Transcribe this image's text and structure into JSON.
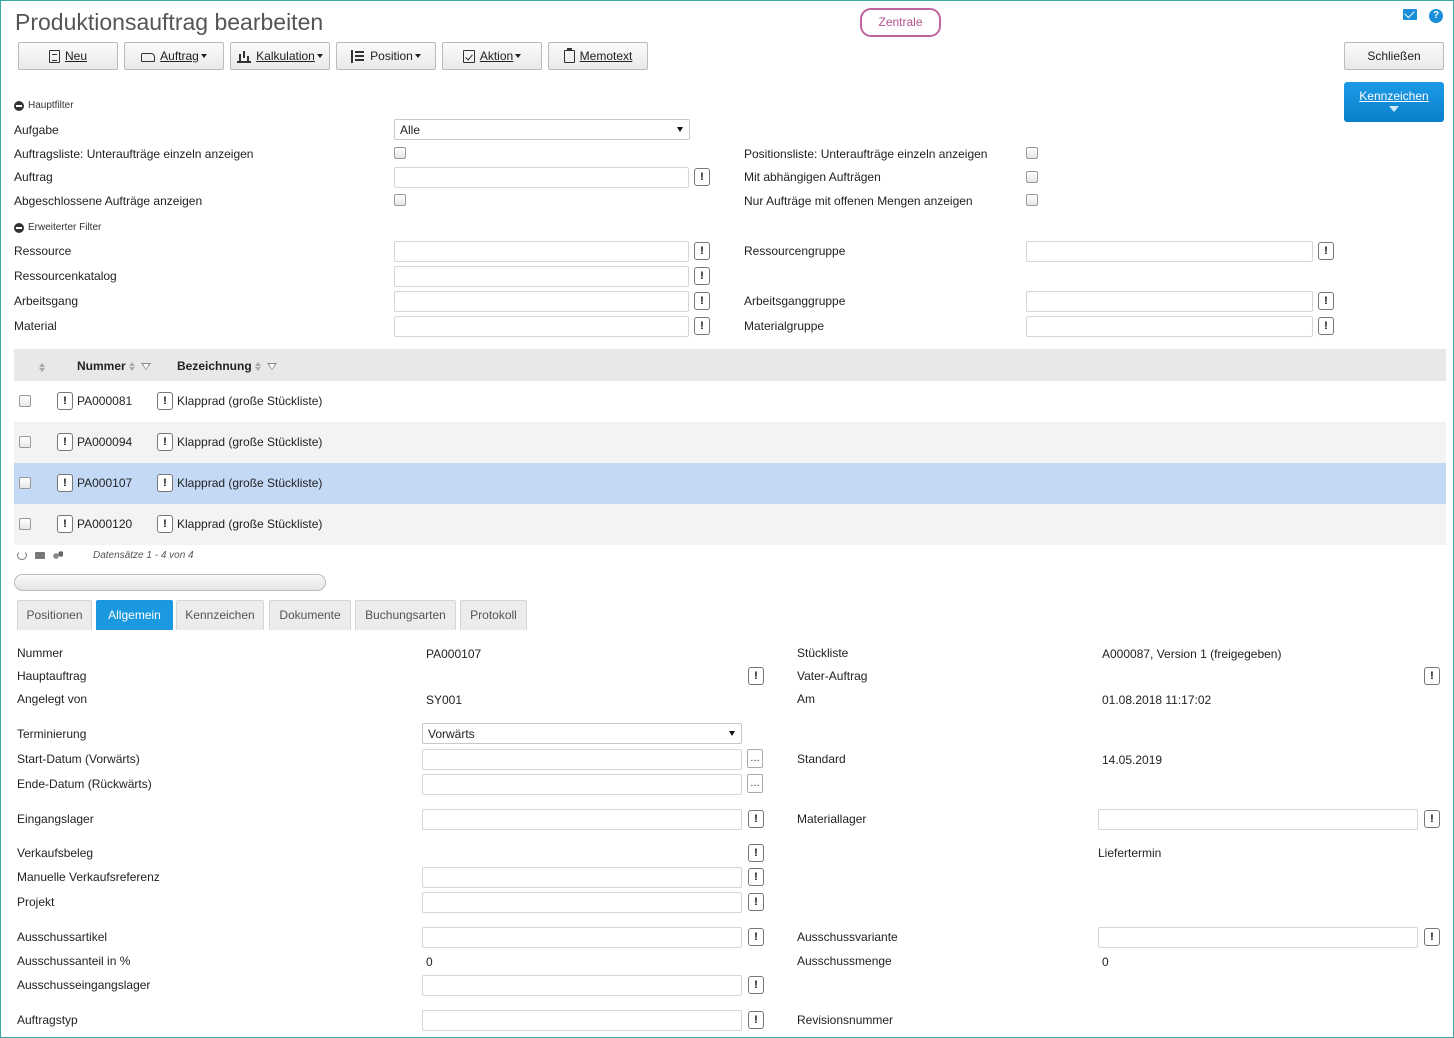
{
  "header": {
    "title": "Produktionsauftrag bearbeiten",
    "zentrale": "Zentrale"
  },
  "toolbar": {
    "neu": "Neu",
    "auftrag": "Auftrag",
    "kalkulation": "Kalkulation",
    "position": "Position",
    "aktion": "Aktion",
    "memotext": "Memotext",
    "schliessen": "Schließen",
    "kennzeichen": "Kennzeichen"
  },
  "hauptfilter": {
    "title": "Hauptfilter",
    "aufgabe_label": "Aufgabe",
    "aufgabe_value": "Alle",
    "unterauftraege_label": "Auftragsliste: Unteraufträge einzeln anzeigen",
    "auftrag_label": "Auftrag",
    "abgeschlossen_label": "Abgeschlossene Aufträge anzeigen",
    "pos_unterauftraege_label": "Positionsliste: Unteraufträge einzeln anzeigen",
    "abhaengig_label": "Mit abhängigen Aufträgen",
    "offene_mengen_label": "Nur Aufträge mit offenen Mengen anzeigen"
  },
  "erweiterter_filter": {
    "title": "Erweiterter Filter",
    "ressource": "Ressource",
    "ressourcenkatalog": "Ressourcenkatalog",
    "arbeitsgang": "Arbeitsgang",
    "material": "Material",
    "ressourcengruppe": "Ressourcengruppe",
    "arbeitsganggruppe": "Arbeitsganggruppe",
    "materialgruppe": "Materialgruppe"
  },
  "grid": {
    "col_nummer": "Nummer",
    "col_bezeichnung": "Bezeichnung",
    "rows": [
      {
        "nummer": "PA000081",
        "bezeichnung": "Klapprad (große Stückliste)"
      },
      {
        "nummer": "PA000094",
        "bezeichnung": "Klapprad (große Stückliste)"
      },
      {
        "nummer": "PA000107",
        "bezeichnung": "Klapprad (große Stückliste)"
      },
      {
        "nummer": "PA000120",
        "bezeichnung": "Klapprad (große Stückliste)"
      }
    ],
    "records": "Datensätze 1 - 4 von 4"
  },
  "tabs": [
    "Positionen",
    "Allgemein",
    "Kennzeichen",
    "Dokumente",
    "Buchungsarten",
    "Protokoll"
  ],
  "detail": {
    "nummer_label": "Nummer",
    "nummer_value": "PA000107",
    "hauptauftrag_label": "Hauptauftrag",
    "angelegt_label": "Angelegt von",
    "angelegt_value": "SY001",
    "terminierung_label": "Terminierung",
    "terminierung_value": "Vorwärts",
    "start_label": "Start-Datum (Vorwärts)",
    "ende_label": "Ende-Datum (Rückwärts)",
    "eingangslager_label": "Eingangslager",
    "verkaufsbeleg_label": "Verkaufsbeleg",
    "manuelle_label": "Manuelle Verkaufsreferenz",
    "projekt_label": "Projekt",
    "ausschussartikel_label": "Ausschussartikel",
    "ausschussanteil_label": "Ausschussanteil in %",
    "ausschussanteil_value": "0",
    "ausschusseingangslager_label": "Ausschusseingangslager",
    "auftragstyp_label": "Auftragstyp",
    "stueckliste_label": "Stückliste",
    "stueckliste_value": "A000087, Version 1 (freigegeben)",
    "vater_label": "Vater-Auftrag",
    "am_label": "Am",
    "am_value": "01.08.2018 11:17:02",
    "standard_label": "Standard",
    "standard_value": "14.05.2019",
    "materiallager_label": "Materiallager",
    "liefertermin_label": "Liefertermin",
    "ausschussvariante_label": "Ausschussvariante",
    "ausschussmenge_label": "Ausschussmenge",
    "ausschussmenge_value": "0",
    "revisionsnummer_label": "Revisionsnummer"
  },
  "colors": {
    "accent": "#1a98e0",
    "selected_row": "#c3d9f6",
    "zentrale_border": "#c0649d"
  }
}
